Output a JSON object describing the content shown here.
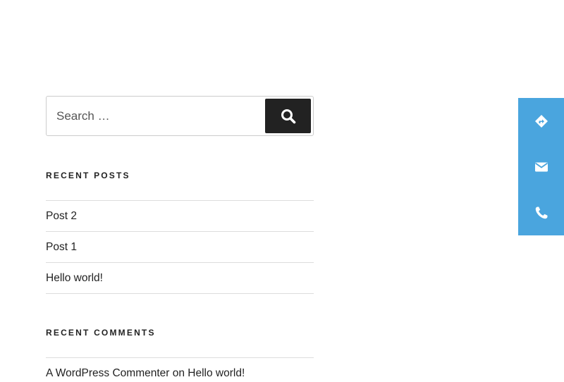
{
  "search": {
    "placeholder": "Search …",
    "button_icon": "search-icon"
  },
  "recent_posts": {
    "title": "RECENT POSTS",
    "items": [
      {
        "label": "Post 2"
      },
      {
        "label": "Post 1"
      },
      {
        "label": "Hello world!"
      }
    ]
  },
  "recent_comments": {
    "title": "RECENT COMMENTS",
    "items": [
      {
        "author": "A WordPress Commenter",
        "connector": " on ",
        "post": "Hello world!"
      }
    ]
  },
  "contact_bar": {
    "color": "#4aa5de",
    "buttons": [
      {
        "icon": "directions-icon"
      },
      {
        "icon": "envelope-icon"
      },
      {
        "icon": "phone-icon"
      }
    ]
  }
}
